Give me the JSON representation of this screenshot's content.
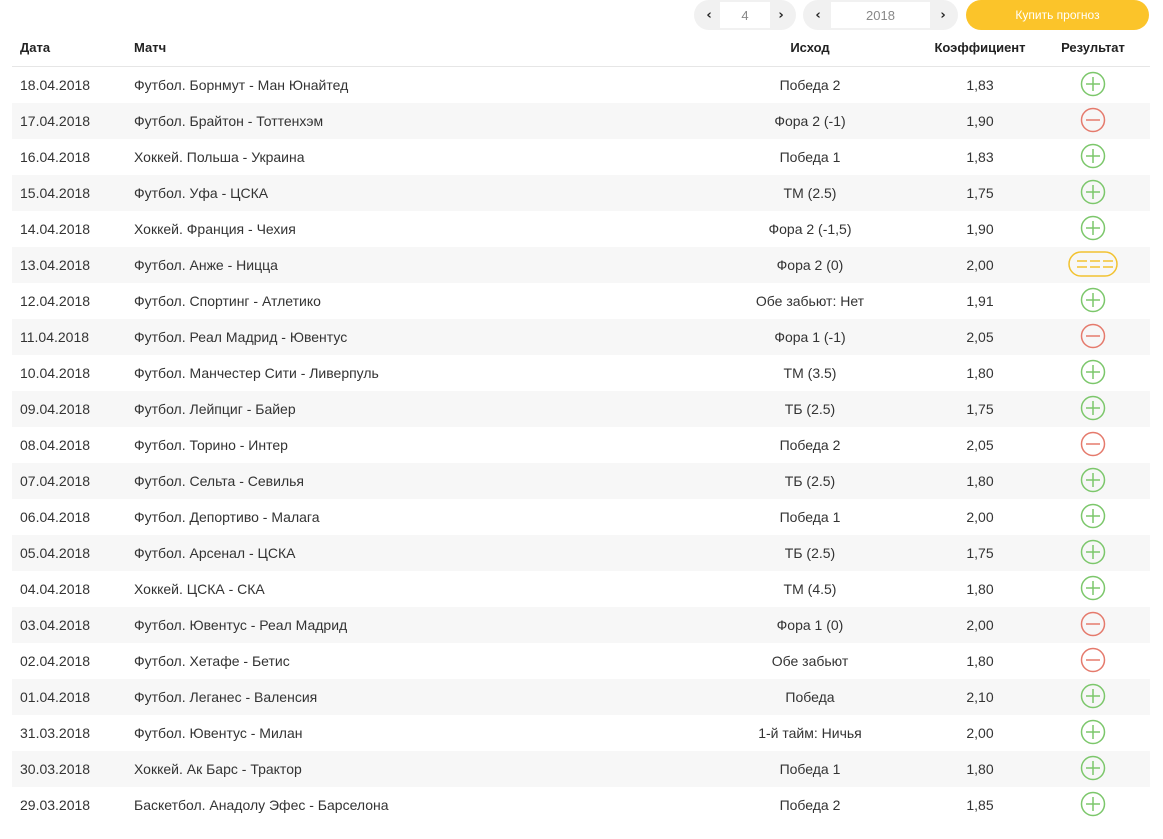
{
  "controls": {
    "month": "4",
    "year": "2018",
    "prev_glyph": "‹",
    "next_glyph": "›",
    "buy_label": "Купить прогноз"
  },
  "colors": {
    "win": "#7cc76b",
    "loss": "#e57a6c",
    "return": "#f2c230",
    "accent": "#fbc42a"
  },
  "table": {
    "headers": {
      "date": "Дата",
      "match": "Матч",
      "outcome": "Исход",
      "coef": "Коэффициент",
      "result": "Результат"
    },
    "rows": [
      {
        "date": "18.04.2018",
        "match": "Футбол. Борнмут - Ман Юнайтед",
        "outcome": "Победа 2",
        "coef": "1,83",
        "result": "win"
      },
      {
        "date": "17.04.2018",
        "match": "Футбол. Брайтон - Тоттенхэм",
        "outcome": "Фора 2 (-1)",
        "coef": "1,90",
        "result": "loss"
      },
      {
        "date": "16.04.2018",
        "match": "Хоккей. Польша - Украина",
        "outcome": "Победа 1",
        "coef": "1,83",
        "result": "win"
      },
      {
        "date": "15.04.2018",
        "match": "Футбол. Уфа - ЦСКА",
        "outcome": "ТМ (2.5)",
        "coef": "1,75",
        "result": "win"
      },
      {
        "date": "14.04.2018",
        "match": "Хоккей. Франция - Чехия",
        "outcome": "Фора 2 (-1,5)",
        "coef": "1,90",
        "result": "win"
      },
      {
        "date": "13.04.2018",
        "match": "Футбол. Анже - Ницца",
        "outcome": "Фора 2 (0)",
        "coef": "2,00",
        "result": "return"
      },
      {
        "date": "12.04.2018",
        "match": "Футбол. Спортинг - Атлетико",
        "outcome": "Обе забьют: Нет",
        "coef": "1,91",
        "result": "win"
      },
      {
        "date": "11.04.2018",
        "match": "Футбол. Реал Мадрид - Ювентус",
        "outcome": "Фора 1 (-1)",
        "coef": "2,05",
        "result": "loss"
      },
      {
        "date": "10.04.2018",
        "match": "Футбол. Манчестер Сити - Ливерпуль",
        "outcome": "ТМ (3.5)",
        "coef": "1,80",
        "result": "win"
      },
      {
        "date": "09.04.2018",
        "match": "Футбол. Лейпциг - Байер",
        "outcome": "ТБ (2.5)",
        "coef": "1,75",
        "result": "win"
      },
      {
        "date": "08.04.2018",
        "match": "Футбол. Торино - Интер",
        "outcome": "Победа 2",
        "coef": "2,05",
        "result": "loss"
      },
      {
        "date": "07.04.2018",
        "match": "Футбол. Сельта - Севилья",
        "outcome": "ТБ (2.5)",
        "coef": "1,80",
        "result": "win"
      },
      {
        "date": "06.04.2018",
        "match": "Футбол. Депортиво - Малага",
        "outcome": "Победа 1",
        "coef": "2,00",
        "result": "win"
      },
      {
        "date": "05.04.2018",
        "match": "Футбол. Арсенал - ЦСКА",
        "outcome": "ТБ (2.5)",
        "coef": "1,75",
        "result": "win"
      },
      {
        "date": "04.04.2018",
        "match": "Хоккей. ЦСКА - СКА",
        "outcome": "ТМ (4.5)",
        "coef": "1,80",
        "result": "win"
      },
      {
        "date": "03.04.2018",
        "match": "Футбол. Ювентус - Реал Мадрид",
        "outcome": "Фора 1 (0)",
        "coef": "2,00",
        "result": "loss"
      },
      {
        "date": "02.04.2018",
        "match": "Футбол. Хетафе - Бетис",
        "outcome": "Обе забьют",
        "coef": "1,80",
        "result": "loss"
      },
      {
        "date": "01.04.2018",
        "match": "Футбол. Леганес - Валенсия",
        "outcome": "Победа",
        "coef": "2,10",
        "result": "win"
      },
      {
        "date": "31.03.2018",
        "match": "Футбол. Ювентус - Милан",
        "outcome": "1-й тайм: Ничья",
        "coef": "2,00",
        "result": "win"
      },
      {
        "date": "30.03.2018",
        "match": "Хоккей. Ак Барс - Трактор",
        "outcome": "Победа 1",
        "coef": "1,80",
        "result": "win"
      },
      {
        "date": "29.03.2018",
        "match": "Баскетбол. Анадолу Эфес - Барселона",
        "outcome": "Победа 2",
        "coef": "1,85",
        "result": "win"
      }
    ]
  }
}
